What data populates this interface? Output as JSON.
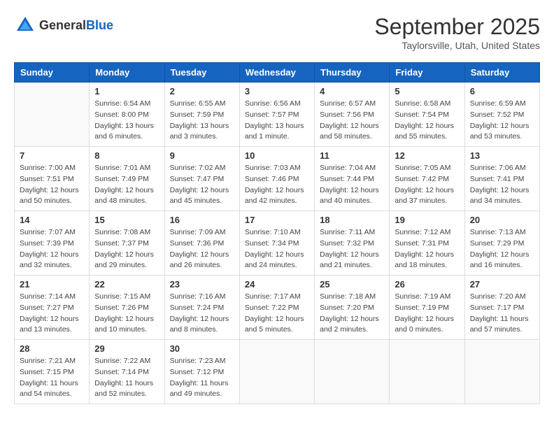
{
  "header": {
    "logo_general": "General",
    "logo_blue": "Blue",
    "month_title": "September 2025",
    "location": "Taylorsville, Utah, United States"
  },
  "days_of_week": [
    "Sunday",
    "Monday",
    "Tuesday",
    "Wednesday",
    "Thursday",
    "Friday",
    "Saturday"
  ],
  "weeks": [
    [
      {
        "day": "",
        "sunrise": "",
        "sunset": "",
        "daylight": ""
      },
      {
        "day": "1",
        "sunrise": "Sunrise: 6:54 AM",
        "sunset": "Sunset: 8:00 PM",
        "daylight": "Daylight: 13 hours and 6 minutes."
      },
      {
        "day": "2",
        "sunrise": "Sunrise: 6:55 AM",
        "sunset": "Sunset: 7:59 PM",
        "daylight": "Daylight: 13 hours and 3 minutes."
      },
      {
        "day": "3",
        "sunrise": "Sunrise: 6:56 AM",
        "sunset": "Sunset: 7:57 PM",
        "daylight": "Daylight: 13 hours and 1 minute."
      },
      {
        "day": "4",
        "sunrise": "Sunrise: 6:57 AM",
        "sunset": "Sunset: 7:56 PM",
        "daylight": "Daylight: 12 hours and 58 minutes."
      },
      {
        "day": "5",
        "sunrise": "Sunrise: 6:58 AM",
        "sunset": "Sunset: 7:54 PM",
        "daylight": "Daylight: 12 hours and 55 minutes."
      },
      {
        "day": "6",
        "sunrise": "Sunrise: 6:59 AM",
        "sunset": "Sunset: 7:52 PM",
        "daylight": "Daylight: 12 hours and 53 minutes."
      }
    ],
    [
      {
        "day": "7",
        "sunrise": "Sunrise: 7:00 AM",
        "sunset": "Sunset: 7:51 PM",
        "daylight": "Daylight: 12 hours and 50 minutes."
      },
      {
        "day": "8",
        "sunrise": "Sunrise: 7:01 AM",
        "sunset": "Sunset: 7:49 PM",
        "daylight": "Daylight: 12 hours and 48 minutes."
      },
      {
        "day": "9",
        "sunrise": "Sunrise: 7:02 AM",
        "sunset": "Sunset: 7:47 PM",
        "daylight": "Daylight: 12 hours and 45 minutes."
      },
      {
        "day": "10",
        "sunrise": "Sunrise: 7:03 AM",
        "sunset": "Sunset: 7:46 PM",
        "daylight": "Daylight: 12 hours and 42 minutes."
      },
      {
        "day": "11",
        "sunrise": "Sunrise: 7:04 AM",
        "sunset": "Sunset: 7:44 PM",
        "daylight": "Daylight: 12 hours and 40 minutes."
      },
      {
        "day": "12",
        "sunrise": "Sunrise: 7:05 AM",
        "sunset": "Sunset: 7:42 PM",
        "daylight": "Daylight: 12 hours and 37 minutes."
      },
      {
        "day": "13",
        "sunrise": "Sunrise: 7:06 AM",
        "sunset": "Sunset: 7:41 PM",
        "daylight": "Daylight: 12 hours and 34 minutes."
      }
    ],
    [
      {
        "day": "14",
        "sunrise": "Sunrise: 7:07 AM",
        "sunset": "Sunset: 7:39 PM",
        "daylight": "Daylight: 12 hours and 32 minutes."
      },
      {
        "day": "15",
        "sunrise": "Sunrise: 7:08 AM",
        "sunset": "Sunset: 7:37 PM",
        "daylight": "Daylight: 12 hours and 29 minutes."
      },
      {
        "day": "16",
        "sunrise": "Sunrise: 7:09 AM",
        "sunset": "Sunset: 7:36 PM",
        "daylight": "Daylight: 12 hours and 26 minutes."
      },
      {
        "day": "17",
        "sunrise": "Sunrise: 7:10 AM",
        "sunset": "Sunset: 7:34 PM",
        "daylight": "Daylight: 12 hours and 24 minutes."
      },
      {
        "day": "18",
        "sunrise": "Sunrise: 7:11 AM",
        "sunset": "Sunset: 7:32 PM",
        "daylight": "Daylight: 12 hours and 21 minutes."
      },
      {
        "day": "19",
        "sunrise": "Sunrise: 7:12 AM",
        "sunset": "Sunset: 7:31 PM",
        "daylight": "Daylight: 12 hours and 18 minutes."
      },
      {
        "day": "20",
        "sunrise": "Sunrise: 7:13 AM",
        "sunset": "Sunset: 7:29 PM",
        "daylight": "Daylight: 12 hours and 16 minutes."
      }
    ],
    [
      {
        "day": "21",
        "sunrise": "Sunrise: 7:14 AM",
        "sunset": "Sunset: 7:27 PM",
        "daylight": "Daylight: 12 hours and 13 minutes."
      },
      {
        "day": "22",
        "sunrise": "Sunrise: 7:15 AM",
        "sunset": "Sunset: 7:26 PM",
        "daylight": "Daylight: 12 hours and 10 minutes."
      },
      {
        "day": "23",
        "sunrise": "Sunrise: 7:16 AM",
        "sunset": "Sunset: 7:24 PM",
        "daylight": "Daylight: 12 hours and 8 minutes."
      },
      {
        "day": "24",
        "sunrise": "Sunrise: 7:17 AM",
        "sunset": "Sunset: 7:22 PM",
        "daylight": "Daylight: 12 hours and 5 minutes."
      },
      {
        "day": "25",
        "sunrise": "Sunrise: 7:18 AM",
        "sunset": "Sunset: 7:20 PM",
        "daylight": "Daylight: 12 hours and 2 minutes."
      },
      {
        "day": "26",
        "sunrise": "Sunrise: 7:19 AM",
        "sunset": "Sunset: 7:19 PM",
        "daylight": "Daylight: 12 hours and 0 minutes."
      },
      {
        "day": "27",
        "sunrise": "Sunrise: 7:20 AM",
        "sunset": "Sunset: 7:17 PM",
        "daylight": "Daylight: 11 hours and 57 minutes."
      }
    ],
    [
      {
        "day": "28",
        "sunrise": "Sunrise: 7:21 AM",
        "sunset": "Sunset: 7:15 PM",
        "daylight": "Daylight: 11 hours and 54 minutes."
      },
      {
        "day": "29",
        "sunrise": "Sunrise: 7:22 AM",
        "sunset": "Sunset: 7:14 PM",
        "daylight": "Daylight: 11 hours and 52 minutes."
      },
      {
        "day": "30",
        "sunrise": "Sunrise: 7:23 AM",
        "sunset": "Sunset: 7:12 PM",
        "daylight": "Daylight: 11 hours and 49 minutes."
      },
      {
        "day": "",
        "sunrise": "",
        "sunset": "",
        "daylight": ""
      },
      {
        "day": "",
        "sunrise": "",
        "sunset": "",
        "daylight": ""
      },
      {
        "day": "",
        "sunrise": "",
        "sunset": "",
        "daylight": ""
      },
      {
        "day": "",
        "sunrise": "",
        "sunset": "",
        "daylight": ""
      }
    ]
  ]
}
